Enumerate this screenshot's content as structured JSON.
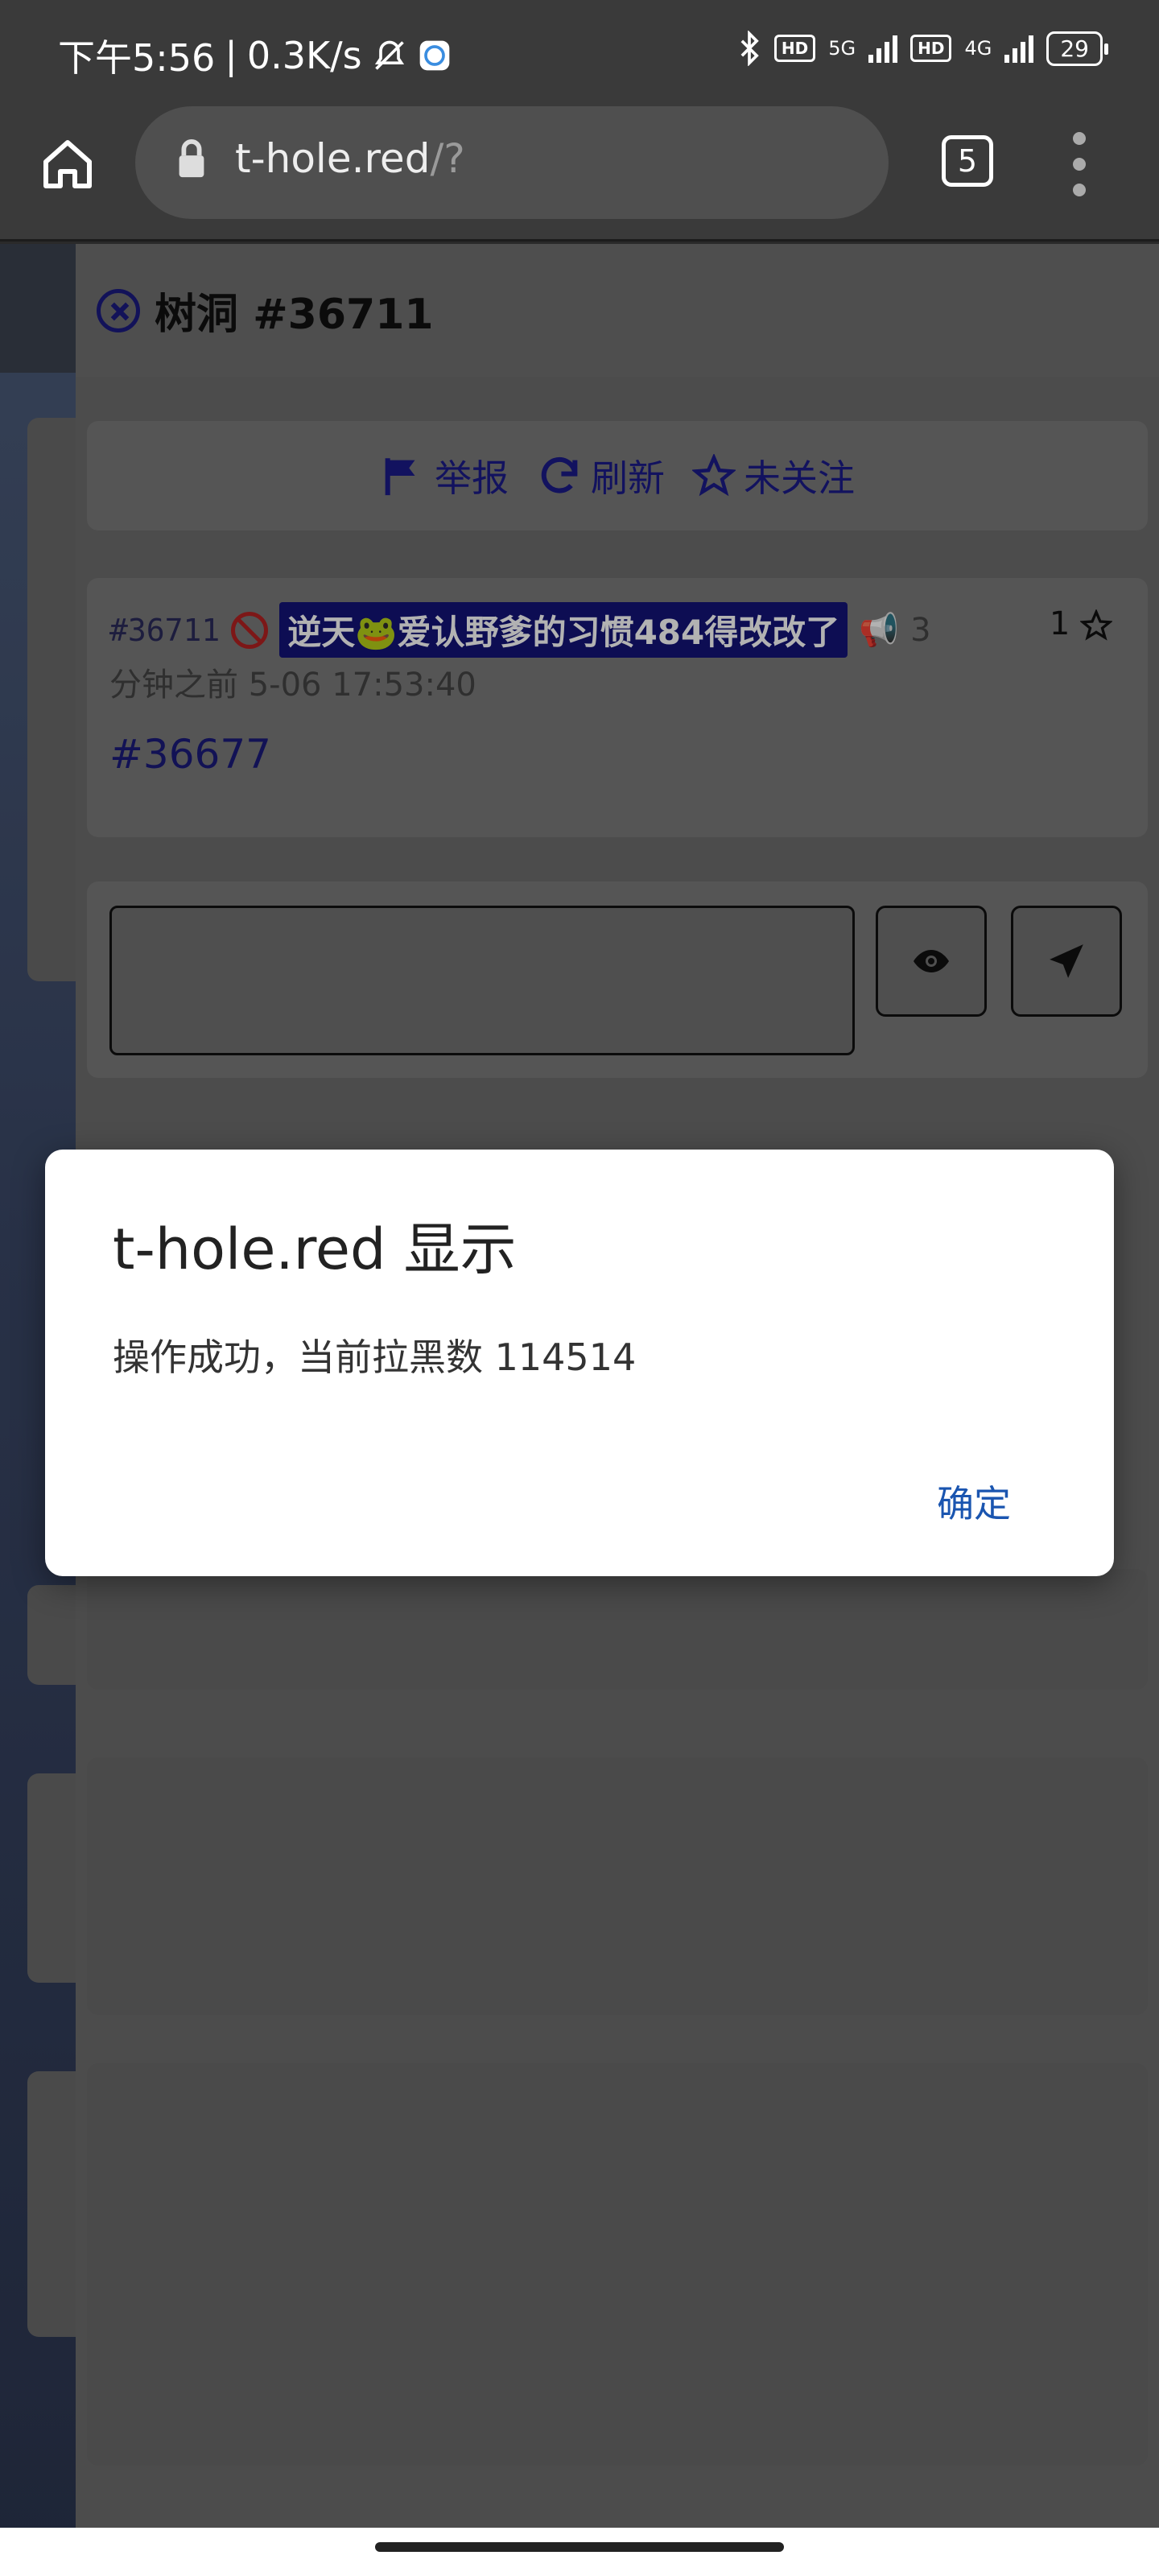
{
  "status_bar": {
    "time": "下午5:56",
    "speed": "0.3K/s",
    "network1": "5G",
    "network2": "4G",
    "hd_label": "HD",
    "battery": "29"
  },
  "browser": {
    "url_domain": "t-hole.red",
    "url_path": "/?",
    "tab_count": "5"
  },
  "flow": {
    "title": "树洞 #36711",
    "actions": {
      "report": "举报",
      "refresh": "刷新",
      "follow": "未关注"
    },
    "post": {
      "id": "#36711",
      "tag": "逆天🐸爱认野爹的习惯484得改改了",
      "time_ago_prefix": "3",
      "time_ago_suffix": "分钟之前",
      "timestamp": "5-06 17:53:40",
      "likes": "1",
      "reference": "#36677"
    }
  },
  "dialog": {
    "title": "t-hole.red 显示",
    "message": "操作成功，当前拉黑数 114514",
    "ok_label": "确定"
  }
}
